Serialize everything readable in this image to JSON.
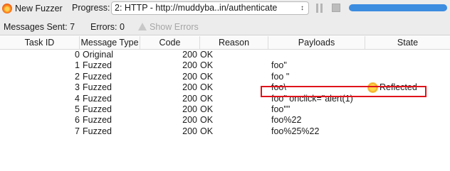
{
  "toolbar": {
    "new_fuzzer_label": "New Fuzzer",
    "progress_label": "Progress:",
    "progress_select_value": "2: HTTP - http://muddyba..in/authenticate",
    "progress_fraction": 1.0
  },
  "status": {
    "messages_sent": "Messages Sent: 7",
    "errors": "Errors: 0",
    "show_errors": "Show Errors"
  },
  "table": {
    "columns": [
      "Task ID",
      "Message Type",
      "Code",
      "Reason",
      "Payloads",
      "State"
    ],
    "rows": [
      {
        "task_id": "0",
        "type": "Original",
        "code": "200",
        "reason": "OK",
        "payload": "",
        "state": ""
      },
      {
        "task_id": "1",
        "type": "Fuzzed",
        "code": "200",
        "reason": "OK",
        "payload": "foo\"",
        "state": ""
      },
      {
        "task_id": "2",
        "type": "Fuzzed",
        "code": "200",
        "reason": "OK",
        "payload": "foo \"",
        "state": ""
      },
      {
        "task_id": "3",
        "type": "Fuzzed",
        "code": "200",
        "reason": "OK",
        "payload": "foo\\",
        "state": "Reflected"
      },
      {
        "task_id": "4",
        "type": "Fuzzed",
        "code": "200",
        "reason": "OK",
        "payload": "foo\" onclick=\"alert(1)",
        "state": ""
      },
      {
        "task_id": "5",
        "type": "Fuzzed",
        "code": "200",
        "reason": "OK",
        "payload": "foo\"\"",
        "state": ""
      },
      {
        "task_id": "6",
        "type": "Fuzzed",
        "code": "200",
        "reason": "OK",
        "payload": "foo%22",
        "state": ""
      },
      {
        "task_id": "7",
        "type": "Fuzzed",
        "code": "200",
        "reason": "OK",
        "payload": "foo%25%22",
        "state": ""
      }
    ]
  },
  "colors": {
    "progress_fill": "#3c8ce0",
    "highlight_border": "#e0131a"
  },
  "icons": {
    "new_fuzzer": "flame-icon",
    "warning": "warning-icon",
    "reflected": "sun-icon"
  }
}
